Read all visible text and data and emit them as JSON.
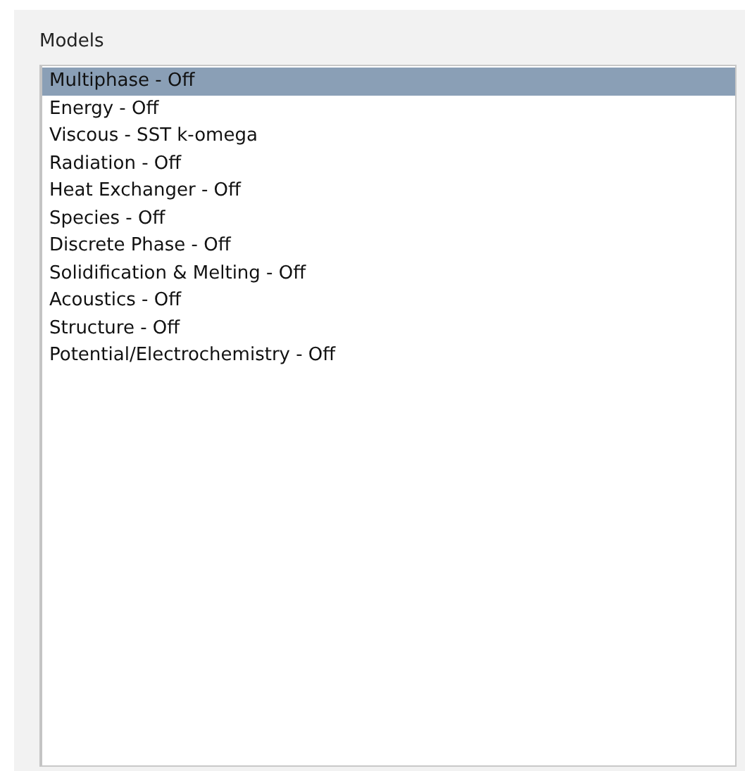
{
  "group": {
    "title": "Models"
  },
  "list": [
    {
      "label": "Multiphase - Off",
      "selected": true
    },
    {
      "label": "Energy - Off",
      "selected": false
    },
    {
      "label": "Viscous - SST k-omega",
      "selected": false
    },
    {
      "label": "Radiation - Off",
      "selected": false
    },
    {
      "label": "Heat Exchanger - Off",
      "selected": false
    },
    {
      "label": "Species - Off",
      "selected": false
    },
    {
      "label": "Discrete Phase - Off",
      "selected": false
    },
    {
      "label": "Solidification & Melting - Off",
      "selected": false
    },
    {
      "label": "Acoustics - Off",
      "selected": false
    },
    {
      "label": "Structure - Off",
      "selected": false
    },
    {
      "label": "Potential/Electrochemistry - Off",
      "selected": false
    }
  ]
}
